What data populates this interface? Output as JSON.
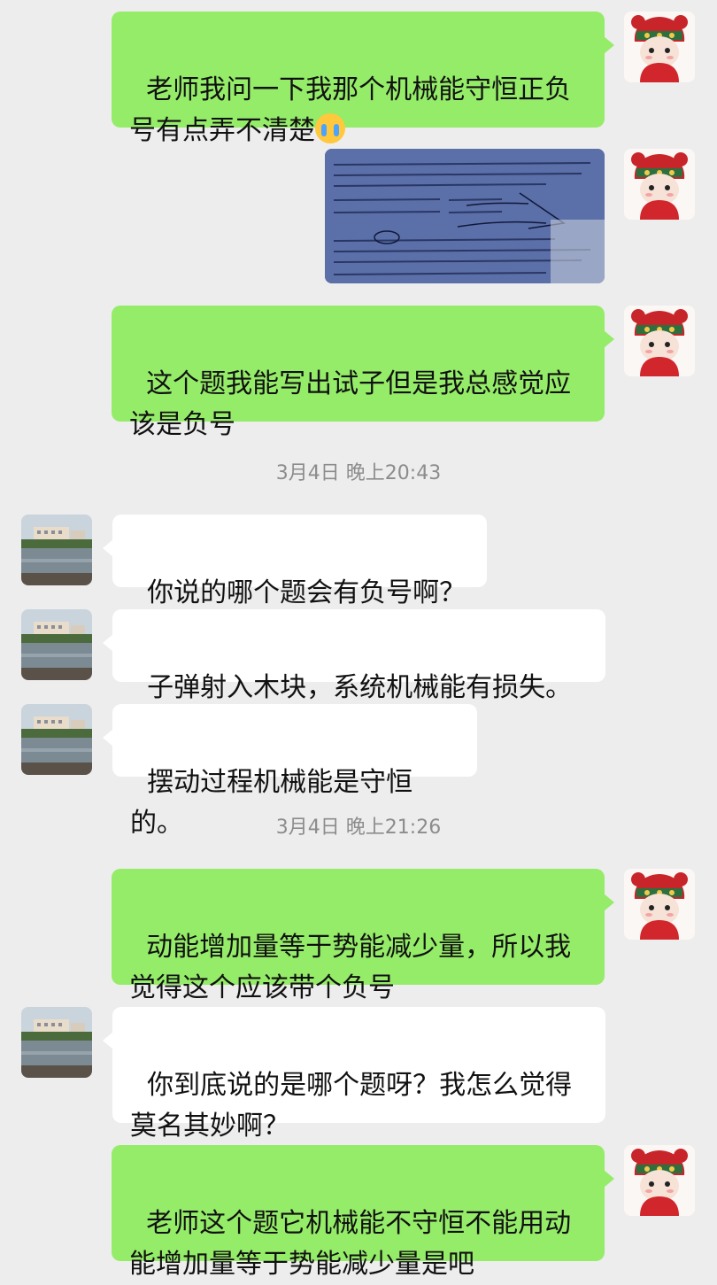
{
  "messages": {
    "m1": "老师我问一下我那个机械能守恒正负号有点弄不清楚",
    "m2": "这个题我能写出试子但是我总感觉应该是负号",
    "t1": "3月4日 晚上20:43",
    "m3": "你说的哪个题会有负号啊？",
    "m4": "子弹射入木块，系统机械能有损失。",
    "m5": "摆动过程机械能是守恒的。",
    "t2": "3月4日 晚上21:26",
    "m6": "动能增加量等于势能减少量，所以我觉得这个应该带个负号",
    "m7": "你到底说的是哪个题呀？我怎么觉得莫名其妙啊？",
    "m8": "老师这个题它机械能不守恒不能用动能增加量等于势能减少量是吧"
  },
  "icons": {
    "emoji_m1": "crying-emoji",
    "me_avatar": "cartoon-girl-avatar",
    "teacher_avatar": "lake-building-avatar"
  },
  "colors": {
    "background": "#ededed",
    "my_bubble": "#95ec69",
    "other_bubble": "#ffffff",
    "timestamp": "#8c8c8c"
  }
}
